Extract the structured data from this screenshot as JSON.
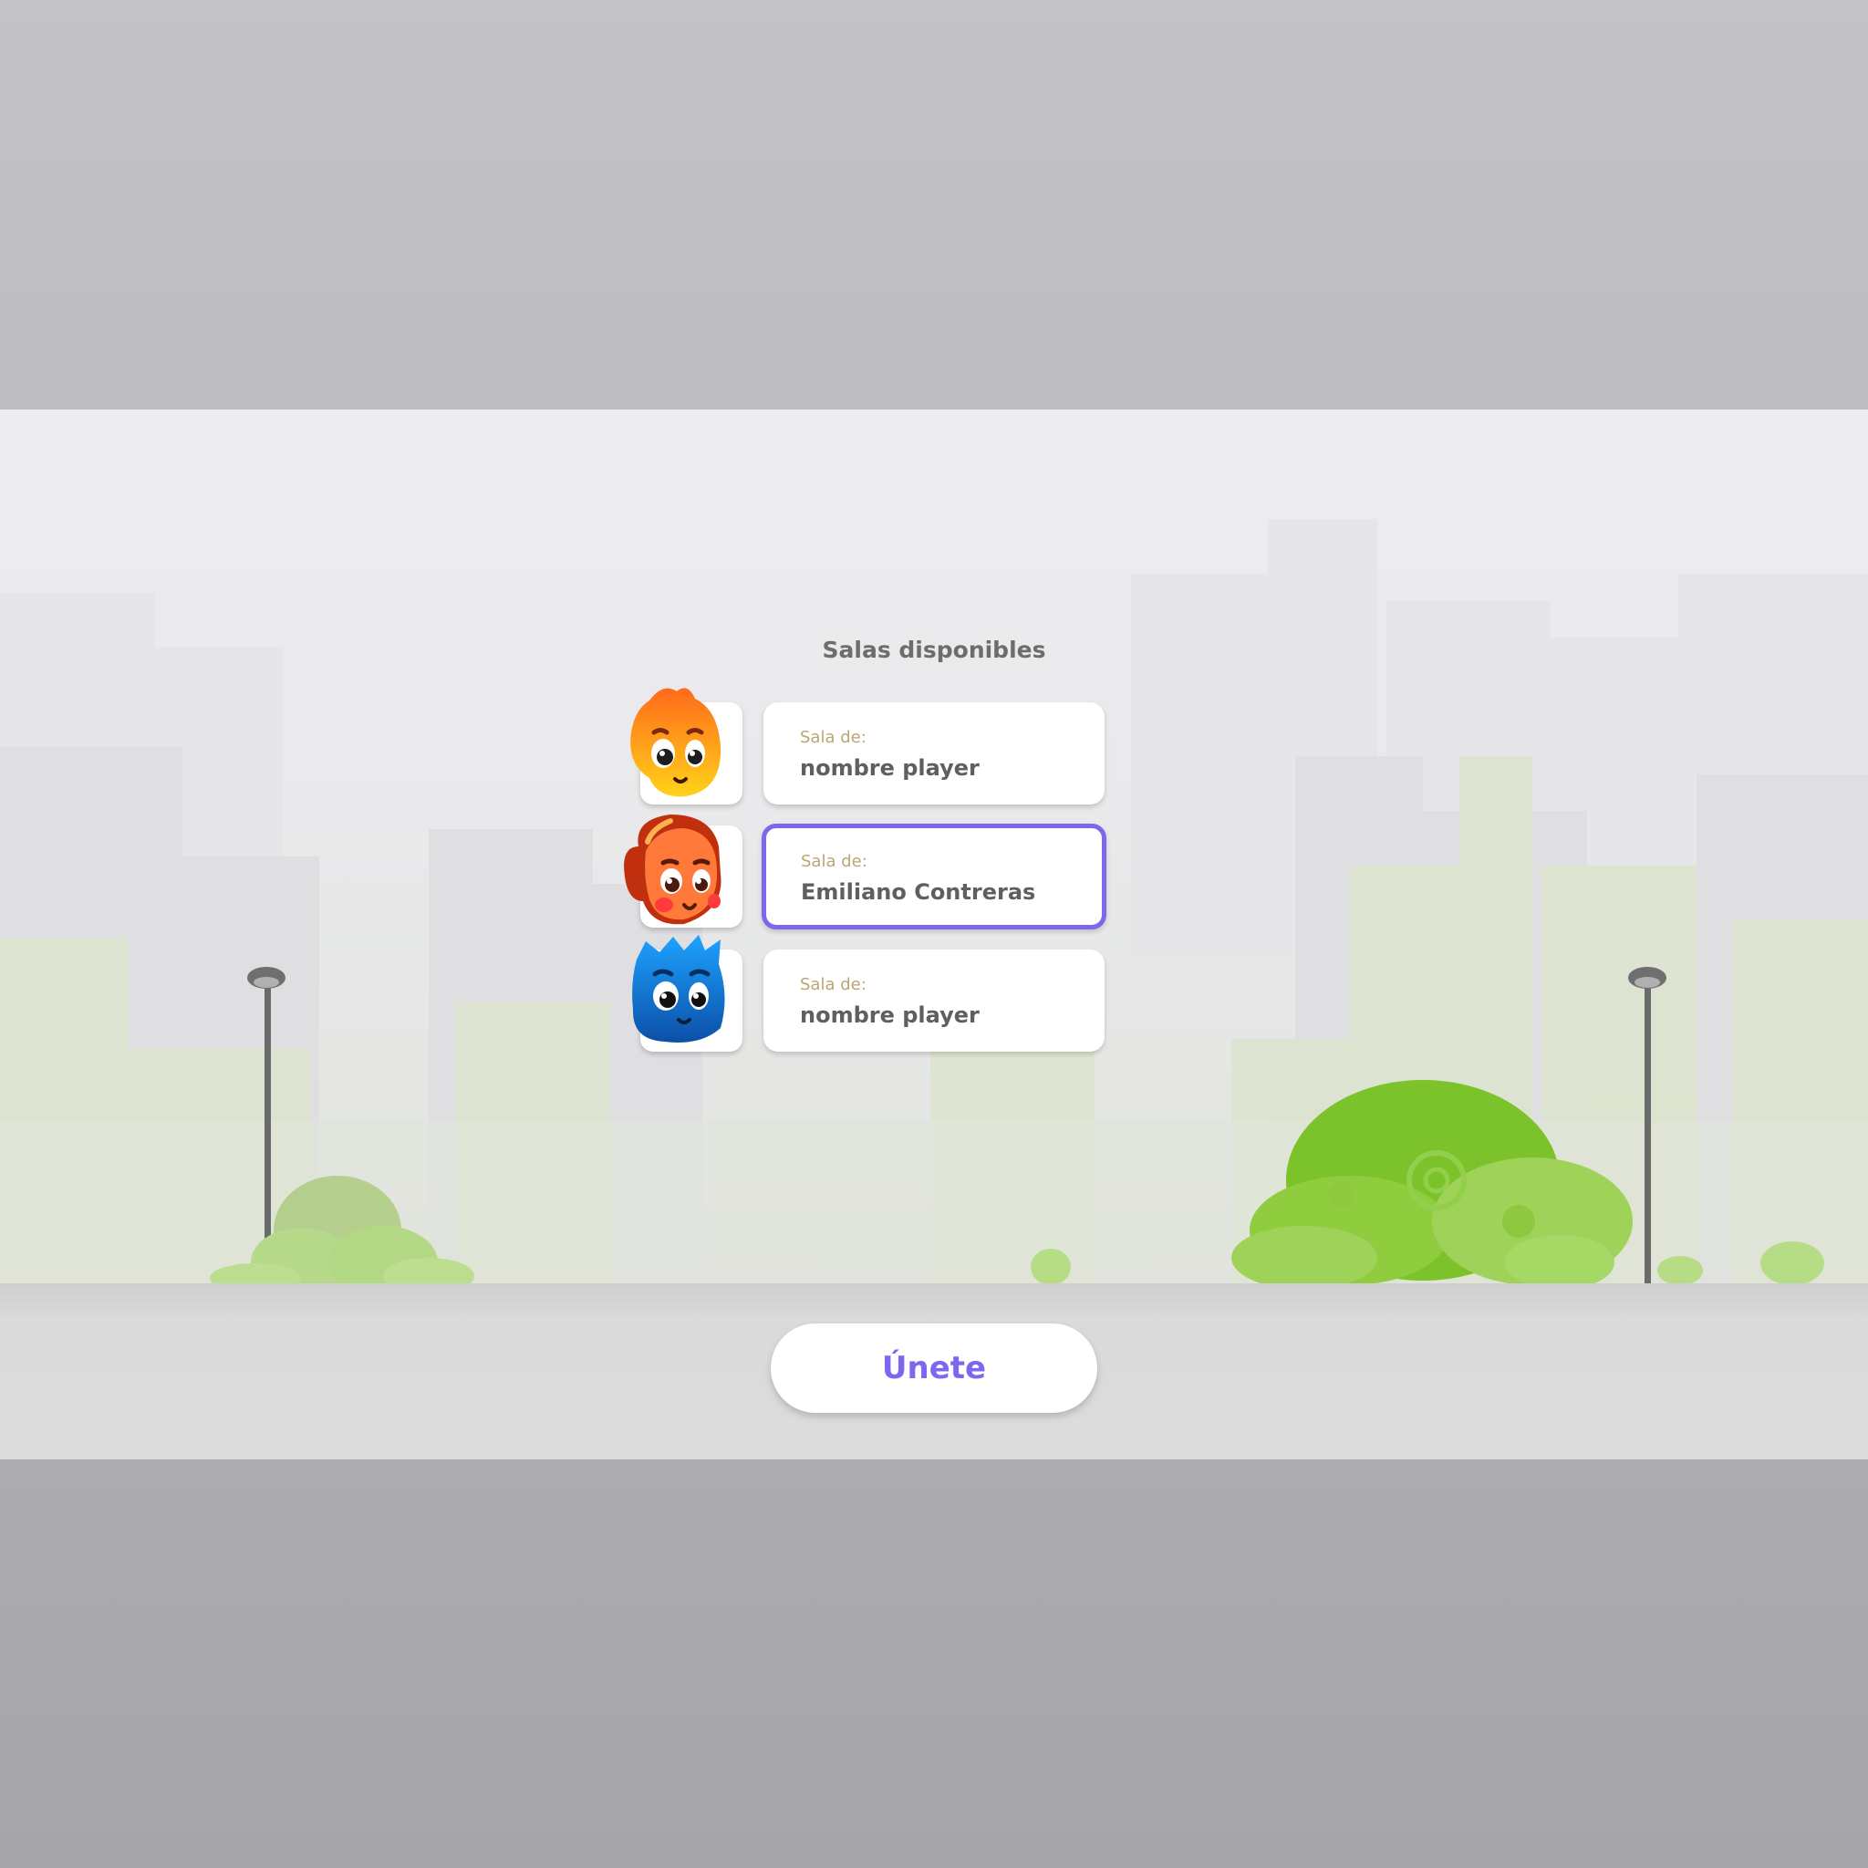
{
  "lobby": {
    "title": "Salas disponibles",
    "rooms": [
      {
        "label": "Sala de:",
        "name": "nombre player",
        "selected": false,
        "avatar": "orange-flame-character-icon"
      },
      {
        "label": "Sala de:",
        "name": "Emiliano Contreras",
        "selected": true,
        "avatar": "redhead-girl-character-icon"
      },
      {
        "label": "Sala de:",
        "name": "nombre player",
        "selected": false,
        "avatar": "blue-spiky-character-icon"
      }
    ],
    "join_label": "Únete"
  },
  "colors": {
    "accent": "#7b68ee",
    "label_gold": "#b8a774",
    "text_gray": "#5f5f5f",
    "bush_green": "#7cc22a"
  }
}
